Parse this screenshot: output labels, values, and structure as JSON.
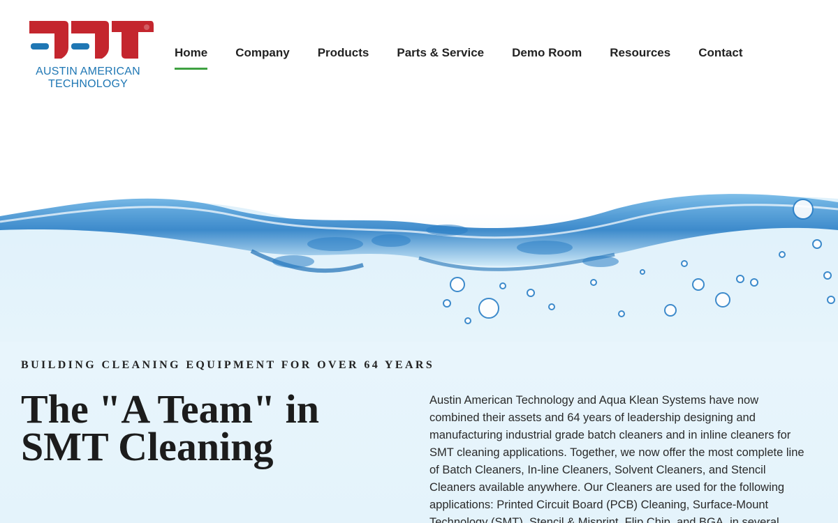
{
  "brand": {
    "logo_text_line1": "AUSTIN AMERICAN",
    "logo_text_line2": "TECHNOLOGY",
    "logo_red": "#c4262e",
    "logo_blue": "#1f77b4"
  },
  "nav": {
    "items": [
      {
        "label": "Home",
        "active": true
      },
      {
        "label": "Company"
      },
      {
        "label": "Products"
      },
      {
        "label": "Parts & Service"
      },
      {
        "label": "Demo Room"
      },
      {
        "label": "Resources"
      },
      {
        "label": "Contact"
      }
    ],
    "active_underline_color": "#3fa142"
  },
  "hero": {
    "eyebrow": "BUILDING CLEANING EQUIPMENT FOR OVER 64 YEARS",
    "headline": "The \"A Team\" in SMT Cleaning",
    "body": "Austin American Technology and Aqua Klean Systems have now combined their assets and 64 years of leadership designing and manufacturing industrial grade batch cleaners and in inline cleaners for SMT cleaning applications.  Together, we now offer the most complete line of Batch Cleaners, In-line Cleaners, Solvent Cleaners, and Stencil Cleaners available anywhere.  Our Cleaners are used for the following applications: Printed Circuit Board (PCB) Cleaning, Surface-Mount Technology (SMT), Stencil & Misprint, Flip Chip, and BGA, in several",
    "image": "water-splash-illustration"
  }
}
